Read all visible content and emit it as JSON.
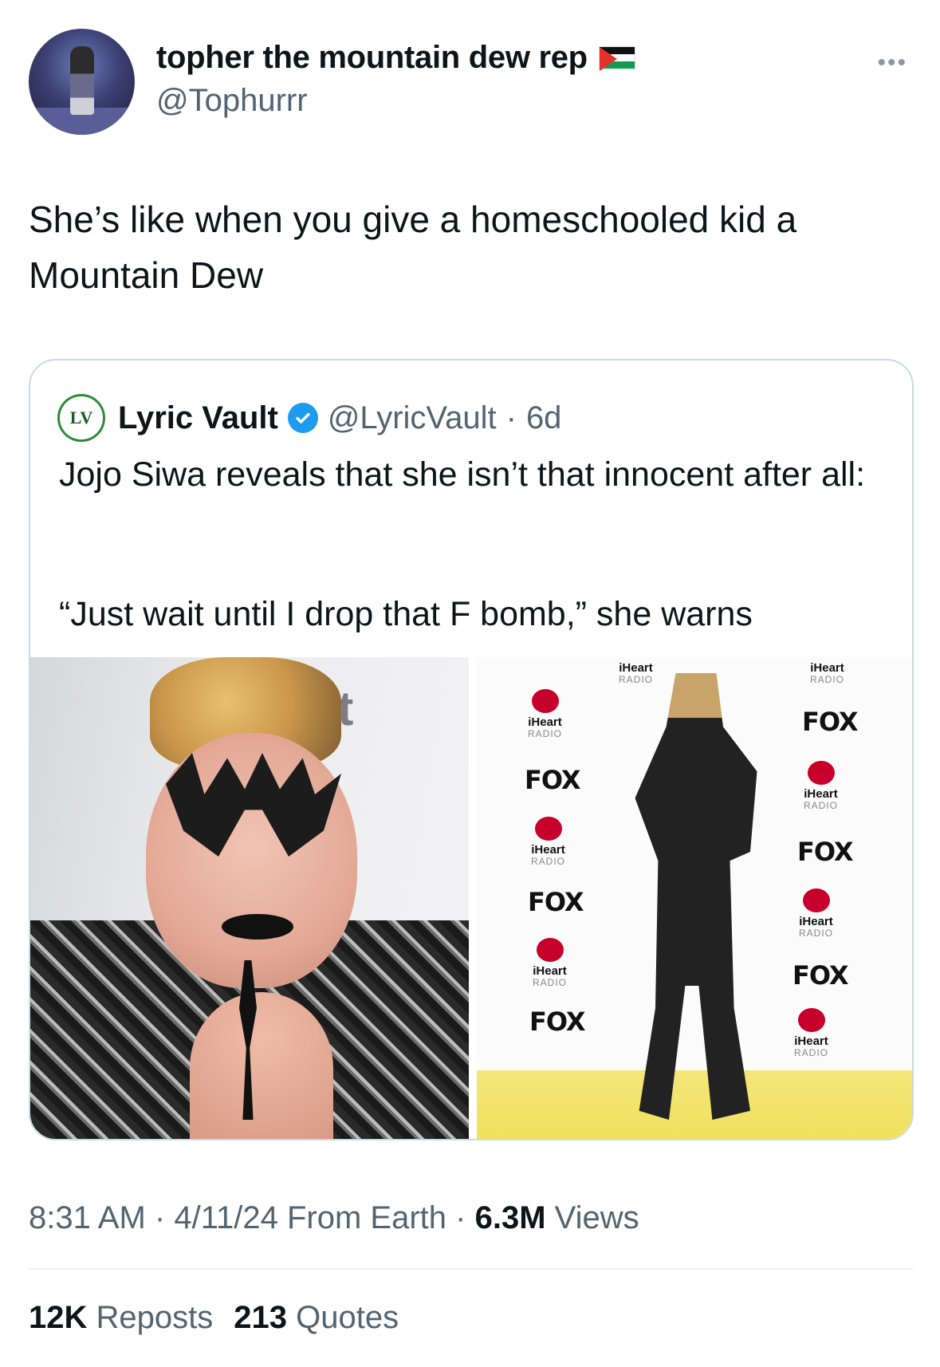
{
  "author": {
    "display_name": "topher the mountain dew rep",
    "handle": "@Tophurrr",
    "flag_icon": "palestine-flag-icon"
  },
  "tweet": {
    "text": "She’s like when you give a homeschooled kid a Mountain Dew"
  },
  "quoted": {
    "logo_text": "LV",
    "name": "Lyric Vault",
    "handle": "@LyricVault",
    "separator": "·",
    "age": "6d",
    "text": "Jojo Siwa reveals that she isn’t that innocent after all:",
    "quote_line": "“Just wait until I drop that F bomb,” she warns",
    "backdrop_text_left": "rt",
    "backdrop_logos": {
      "fox": "FOX",
      "iheart": "iHeart",
      "radio": "RADIO"
    }
  },
  "meta": {
    "time": "8:31 AM",
    "sep1": "·",
    "date": "4/11/24",
    "source": "From Earth",
    "sep2": "·",
    "views_count": "6.3M",
    "views_label": "Views"
  },
  "stats": {
    "reposts_count": "12K",
    "reposts_label": "Reposts",
    "quotes_count": "213",
    "quotes_label": "Quotes"
  },
  "colors": {
    "text": "#0f1419",
    "secondary": "#536471",
    "verified": "#1d9bf0",
    "border": "#cfd9de"
  }
}
